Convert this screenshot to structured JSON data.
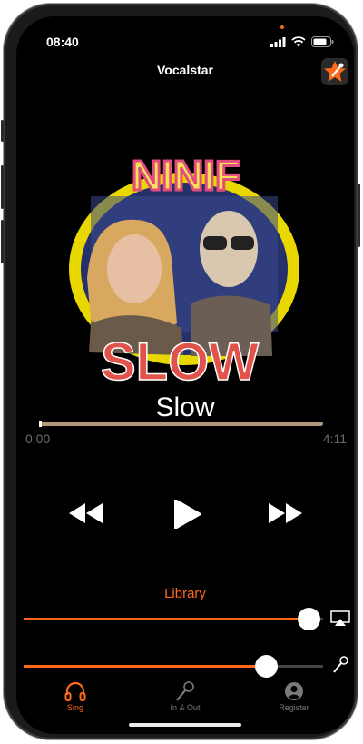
{
  "status_bar": {
    "time": "08:40"
  },
  "nav": {
    "title": "Vocalstar"
  },
  "artwork": {
    "top_text": "NINIF",
    "bottom_text": "SLOW"
  },
  "player": {
    "song_title": "Slow",
    "elapsed": "0:00",
    "duration": "4:11",
    "progress": 0.0
  },
  "library_label": "Library",
  "sliders": {
    "volume_level": 0.95,
    "mic_level": 0.81
  },
  "tabs": [
    {
      "label": "Sing",
      "icon": "headphones-icon",
      "active": true
    },
    {
      "label": "In & Out",
      "icon": "microphone-icon",
      "active": false
    },
    {
      "label": "Register",
      "icon": "user-icon",
      "active": false
    }
  ],
  "colors": {
    "accent": "#ff6a1a",
    "background": "#000000"
  }
}
